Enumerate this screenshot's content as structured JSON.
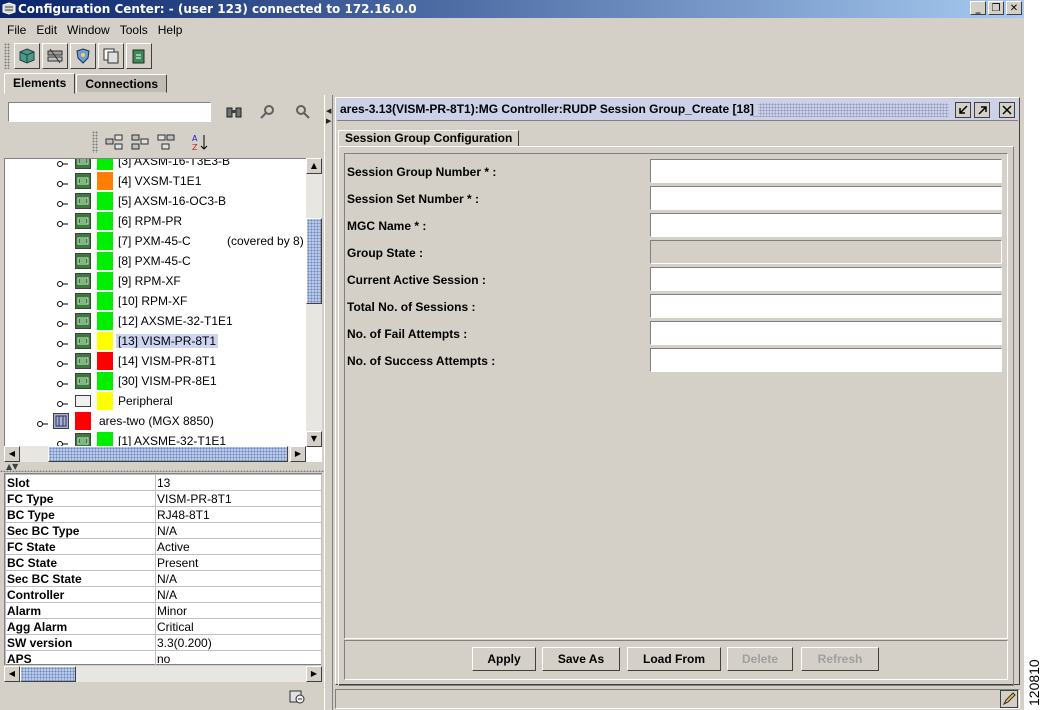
{
  "window": {
    "title": "Configuration Center: - (user 123) connected to 172.16.0.0",
    "controls": [
      "_",
      "❐",
      "✕"
    ]
  },
  "menu": [
    {
      "label": "File"
    },
    {
      "label": "Edit"
    },
    {
      "label": "Window"
    },
    {
      "label": "Tools"
    },
    {
      "label": "Help"
    }
  ],
  "toolbar": {
    "icons": [
      "cube-icon",
      "network-icon",
      "shield-icon",
      "copy-icon",
      "export-icon"
    ]
  },
  "tabs": [
    {
      "label": "Elements",
      "active": true
    },
    {
      "label": "Connections",
      "active": false
    }
  ],
  "search": {
    "value": "",
    "placeholder": ""
  },
  "tree": {
    "rows": [
      {
        "label": "[3] AXSM-16-T3E3-B",
        "status": "green",
        "indent": 1
      },
      {
        "label": "[4] VXSM-T1E1",
        "status": "orange",
        "indent": 1
      },
      {
        "label": "[5] AXSM-16-OC3-B",
        "status": "green",
        "indent": 1
      },
      {
        "label": "[6] RPM-PR",
        "status": "green",
        "indent": 1
      },
      {
        "label": "[7] PXM-45-C",
        "status": "green",
        "indent": 1,
        "note": "(covered by 8)",
        "leaf": true
      },
      {
        "label": "[8] PXM-45-C",
        "status": "green",
        "indent": 1,
        "leaf": true
      },
      {
        "label": "[9] RPM-XF",
        "status": "green",
        "indent": 1
      },
      {
        "label": "[10] RPM-XF",
        "status": "green",
        "indent": 1
      },
      {
        "label": "[12] AXSME-32-T1E1",
        "status": "green",
        "indent": 1
      },
      {
        "label": "[13] VISM-PR-8T1",
        "status": "yellow",
        "indent": 1,
        "selected": true
      },
      {
        "label": "[14] VISM-PR-8T1",
        "status": "red",
        "indent": 1
      },
      {
        "label": "[30] VISM-PR-8E1",
        "status": "green",
        "indent": 1
      },
      {
        "label": "Peripheral",
        "status": "yellow",
        "indent": 1,
        "folder": true
      },
      {
        "label": "ares-two (MGX 8850)",
        "status": "red",
        "indent": 0,
        "node": true
      },
      {
        "label": "[1] AXSME-32-T1E1",
        "status": "green",
        "indent": 1
      }
    ]
  },
  "properties": [
    {
      "key": "Slot",
      "value": "13"
    },
    {
      "key": "FC Type",
      "value": "VISM-PR-8T1"
    },
    {
      "key": "BC Type",
      "value": "RJ48-8T1"
    },
    {
      "key": "Sec BC Type",
      "value": "N/A"
    },
    {
      "key": "FC State",
      "value": "Active"
    },
    {
      "key": "BC State",
      "value": "Present"
    },
    {
      "key": "Sec BC State",
      "value": "N/A"
    },
    {
      "key": "Controller",
      "value": "N/A"
    },
    {
      "key": "Alarm",
      "value": "Minor"
    },
    {
      "key": "Agg Alarm",
      "value": "Critical"
    },
    {
      "key": "SW version",
      "value": "3.3(0.200)"
    },
    {
      "key": "APS",
      "value": "no"
    }
  ],
  "frame": {
    "title": "ares-3.13(VISM-PR-8T1):MG Controller:RUDP Session Group_Create [18]",
    "tab": "Session Group Configuration",
    "fields": [
      {
        "label": "Session Group Number * :",
        "value": "",
        "type": "text"
      },
      {
        "label": "Session Set Number * :",
        "value": "",
        "type": "text"
      },
      {
        "label": "MGC Name * :",
        "value": "",
        "type": "text"
      },
      {
        "label": "Group State :",
        "value": "",
        "type": "select",
        "disabled": true
      },
      {
        "label": "Current Active Session :",
        "value": "",
        "type": "text"
      },
      {
        "label": "Total No. of Sessions :",
        "value": "",
        "type": "text"
      },
      {
        "label": "No. of Fail Attempts :",
        "value": "",
        "type": "text"
      },
      {
        "label": "No. of Success Attempts :",
        "value": "",
        "type": "text"
      }
    ],
    "buttons": [
      {
        "label": "Apply",
        "enabled": true
      },
      {
        "label": "Save As",
        "enabled": true
      },
      {
        "label": "Load From",
        "enabled": true
      },
      {
        "label": "Delete",
        "enabled": false
      },
      {
        "label": "Refresh",
        "enabled": false
      }
    ]
  },
  "figure_id": "120810",
  "colors": {
    "green": "#00ee00",
    "orange": "#ff8000",
    "yellow": "#ffff00",
    "red": "#ff0000",
    "selected": "#ccd4f0",
    "title_start": "#0a246a",
    "title_end": "#a6caf0"
  }
}
